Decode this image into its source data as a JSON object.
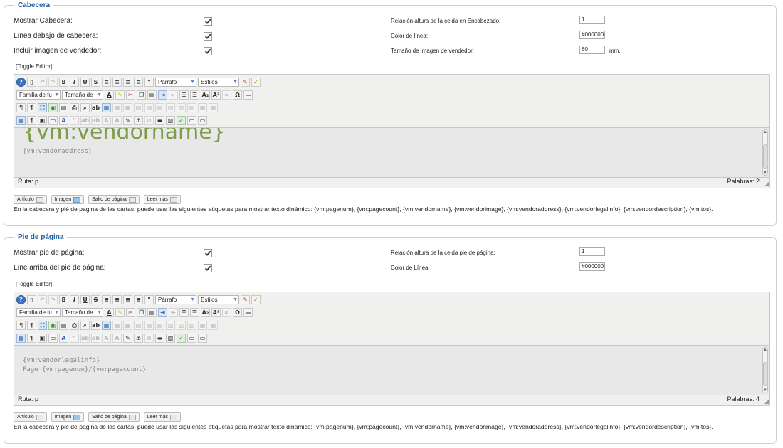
{
  "header_section": {
    "legend": "Cabecera",
    "fields": [
      {
        "label": "Mostrar Cabecera:",
        "checked": true
      },
      {
        "label": "Línea debajo de cabecera:",
        "checked": true
      },
      {
        "label": "Incluir imagen de vendedor:",
        "checked": true
      }
    ],
    "right_fields": [
      {
        "label": "Relación altura de la celda en Encabezado:",
        "value": "1",
        "unit": ""
      },
      {
        "label": "Color de línea:",
        "value": "#000000",
        "unit": ""
      },
      {
        "label": "Tamaño de imagen de vendedor:",
        "value": "60",
        "unit": "mm."
      }
    ],
    "toggle": "[Toggle Editor]",
    "content_big": "{vm:vendorname}",
    "content_lines": [
      "{vm:vendoraddress}"
    ],
    "path": "Ruta: p",
    "words": "Palabras: 2"
  },
  "footer_section": {
    "legend": "Pie de página",
    "fields": [
      {
        "label": "Mostrar pie de página:",
        "checked": true
      },
      {
        "label": "Líne arriba del pie de página:",
        "checked": true
      }
    ],
    "right_fields": [
      {
        "label": "Relación altura de la celda pie de página:",
        "value": "1",
        "unit": ""
      },
      {
        "label": "Color de Línea:",
        "value": "#000000",
        "unit": ""
      }
    ],
    "toggle": "[Toggle Editor]",
    "content_lines": [
      "{vm:vendorlegalinfo}",
      "Page {vm:pagenum}/{vm:pagecount}"
    ],
    "path": "Ruta: p",
    "words": "Palabras: 4"
  },
  "toolbar": {
    "format_select": "Párrafo",
    "styles_select": "Estilos",
    "font_family_select": "Familia de fu",
    "font_size_select": "Tamaño de l"
  },
  "editor_buttons": {
    "article": "Artículo",
    "image": "Imagen",
    "pagebreak": "Salto de página",
    "readmore": "Leer más"
  },
  "info_text": "En la cabecera y pié de pagina de las cartas, puede usar las siguientes etiquetas para mostrar texto dinámico: {vm:pagenum}, {vm:pagecount}, {vm:vendorname}, {vm:vendorimage}, {vm:vendoraddress}, {vm:vendorlegalinfo}, {vm:vendordescription}, {vm:tos}.",
  "colors": {
    "legend": "#1f5f9f",
    "vendorname": "#7e9c4b",
    "editor_bg": "#e8e8e8"
  }
}
